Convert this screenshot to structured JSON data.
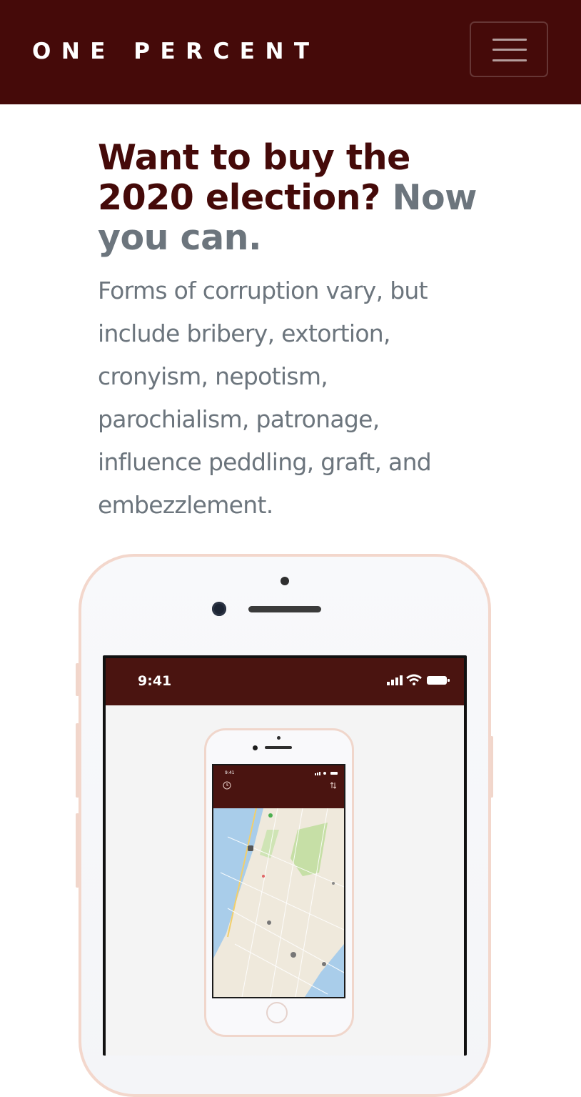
{
  "navbar": {
    "brand": "ONE PERCENT",
    "menu_icon": "hamburger-menu-icon",
    "background_color": "#450a09"
  },
  "hero": {
    "headline_main": "Want to buy the 2020 election?",
    "headline_accent": "Now you can.",
    "lead": "Forms of corruption vary, but include bribery, extortion, cronyism, nepotism, parochialism, patronage, influence peddling, graft, and embezzlement.",
    "headline_color": "#450a09",
    "accent_color": "#6c757d"
  },
  "phone_mockup": {
    "time": "9:41",
    "status_icons": [
      "signal-icon",
      "wifi-icon",
      "battery-icon"
    ],
    "inner_app": {
      "time": "9:41",
      "location": "",
      "tabs": [
        "",
        "",
        "",
        ""
      ]
    }
  }
}
